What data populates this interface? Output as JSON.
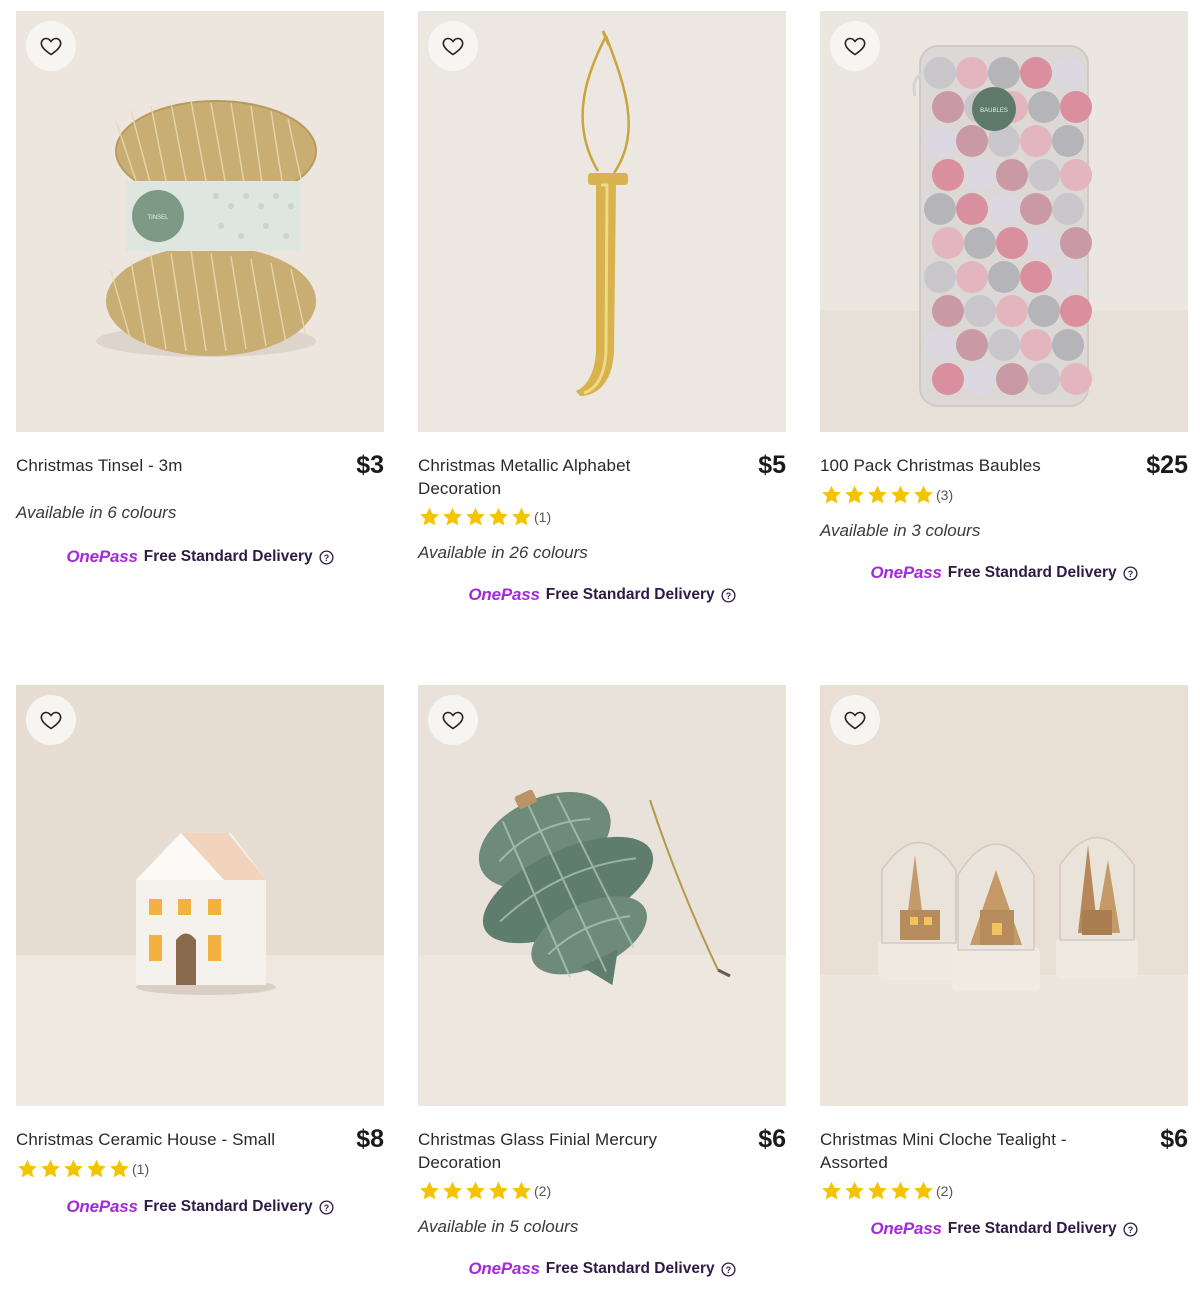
{
  "colors": {
    "onepass_purple": "#a12bd6",
    "delivery_text": "#2d1b46",
    "star_gold": "#f5c400",
    "image_bg": "#ece6df"
  },
  "products": [
    {
      "name": "Christmas Tinsel - 3m",
      "price": "$3",
      "has_rating": false,
      "availability": "Available in 6 colours",
      "onepass_label": "OnePass",
      "delivery_label": "Free Standard Delivery",
      "image_icon": "gold-tinsel-image"
    },
    {
      "name": "Christmas Metallic Alphabet Decoration",
      "price": "$5",
      "has_rating": true,
      "rating": 5,
      "rating_count": "(1)",
      "availability": "Available in 26 colours",
      "onepass_label": "OnePass",
      "delivery_label": "Free Standard Delivery",
      "image_icon": "gold-letter-j-image"
    },
    {
      "name": "100 Pack Christmas Baubles",
      "price": "$25",
      "has_rating": true,
      "rating": 5,
      "rating_count": "(3)",
      "availability": "Available in 3 colours",
      "onepass_label": "OnePass",
      "delivery_label": "Free Standard Delivery",
      "image_icon": "baubles-tube-image",
      "image_label": "BAUBLES"
    },
    {
      "name": "Christmas Ceramic House - Small",
      "price": "$8",
      "has_rating": true,
      "rating": 5,
      "rating_count": "(1)",
      "availability": "",
      "onepass_label": "OnePass",
      "delivery_label": "Free Standard Delivery",
      "image_icon": "ceramic-house-image"
    },
    {
      "name": "Christmas Glass Finial Mercury Decoration",
      "price": "$6",
      "has_rating": true,
      "rating": 5,
      "rating_count": "(2)",
      "availability": "Available in 5 colours",
      "onepass_label": "OnePass",
      "delivery_label": "Free Standard Delivery",
      "image_icon": "green-glass-ornament-image"
    },
    {
      "name": "Christmas Mini Cloche Tealight - Assorted",
      "price": "$6",
      "has_rating": true,
      "rating": 5,
      "rating_count": "(2)",
      "availability": "",
      "onepass_label": "OnePass",
      "delivery_label": "Free Standard Delivery",
      "image_icon": "cloche-tealights-image"
    }
  ],
  "tinsel_label": "TINSEL"
}
